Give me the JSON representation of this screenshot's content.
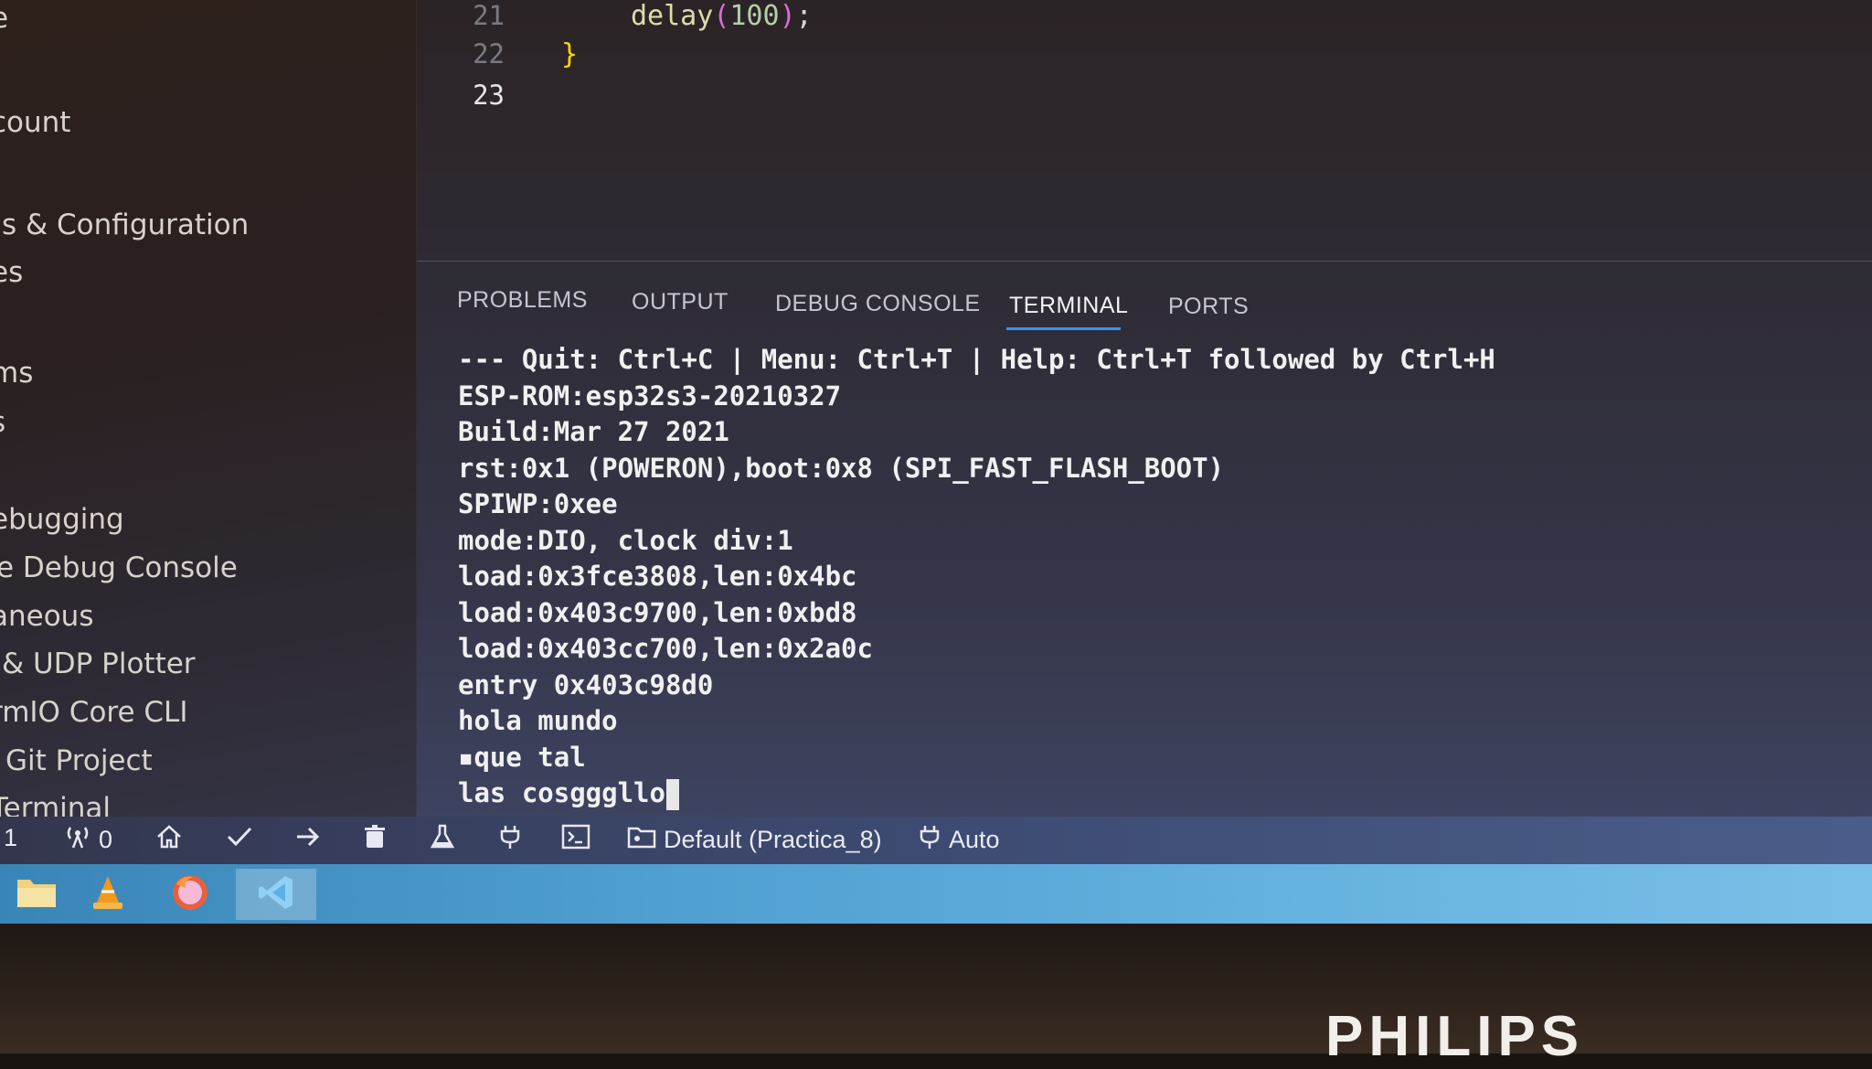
{
  "sidebar": {
    "items": [
      {
        "label": "e"
      },
      {
        "label": "count"
      },
      {
        "label": "s & Configuration"
      },
      {
        "label": "es"
      },
      {
        "label": "ms"
      },
      {
        "label": "s"
      },
      {
        "label": "ebugging"
      },
      {
        "label": "e Debug Console"
      },
      {
        "label": "aneous"
      },
      {
        "label": "& UDP Plotter"
      },
      {
        "label": "rmIO Core CLI"
      },
      {
        "label": "Git Project"
      },
      {
        "label": "Terminal"
      }
    ]
  },
  "editor": {
    "lines": [
      {
        "number": "21",
        "code": "delay(100);"
      },
      {
        "number": "22",
        "code": "}"
      },
      {
        "number": "23",
        "code": ""
      }
    ],
    "colors": {
      "function": "#dcdcaa",
      "paren": "#da70d6",
      "number": "#b5cea8",
      "brace": "#ffd700"
    }
  },
  "panel": {
    "tabs": [
      {
        "label": "PROBLEMS"
      },
      {
        "label": "OUTPUT"
      },
      {
        "label": "DEBUG CONSOLE"
      },
      {
        "label": "TERMINAL",
        "active": true
      },
      {
        "label": "PORTS"
      }
    ],
    "terminal_lines": [
      "--- Quit: Ctrl+C | Menu: Ctrl+T | Help: Ctrl+T followed by Ctrl+H",
      "ESP-ROM:esp32s3-20210327",
      "Build:Mar 27 2021",
      "rst:0x1 (POWERON),boot:0x8 (SPI_FAST_FLASH_BOOT)",
      "SPIWP:0xee",
      "mode:DIO, clock div:1",
      "load:0x3fce3808,len:0x4bc",
      "load:0x403c9700,len:0xbd8",
      "load:0x403cc700,len:0x2a0c",
      "entry 0x403c98d0",
      "hola mundo",
      "▪que tal",
      "las cosgggllo"
    ]
  },
  "statusbar": {
    "errors_count": "1",
    "ports_count": "0",
    "env_label": "Default (Practica_8)",
    "auto_label": "Auto",
    "icons": [
      "home-icon",
      "check-icon",
      "arrow-right-icon",
      "trash-icon",
      "flask-icon",
      "plug-icon",
      "terminal-icon",
      "folder-icon"
    ]
  },
  "taskbar": {
    "apps": [
      "file-manager-icon",
      "vlc-icon",
      "firefox-icon",
      "vscode-icon"
    ]
  },
  "monitor": {
    "brand": "PHILIPS"
  }
}
